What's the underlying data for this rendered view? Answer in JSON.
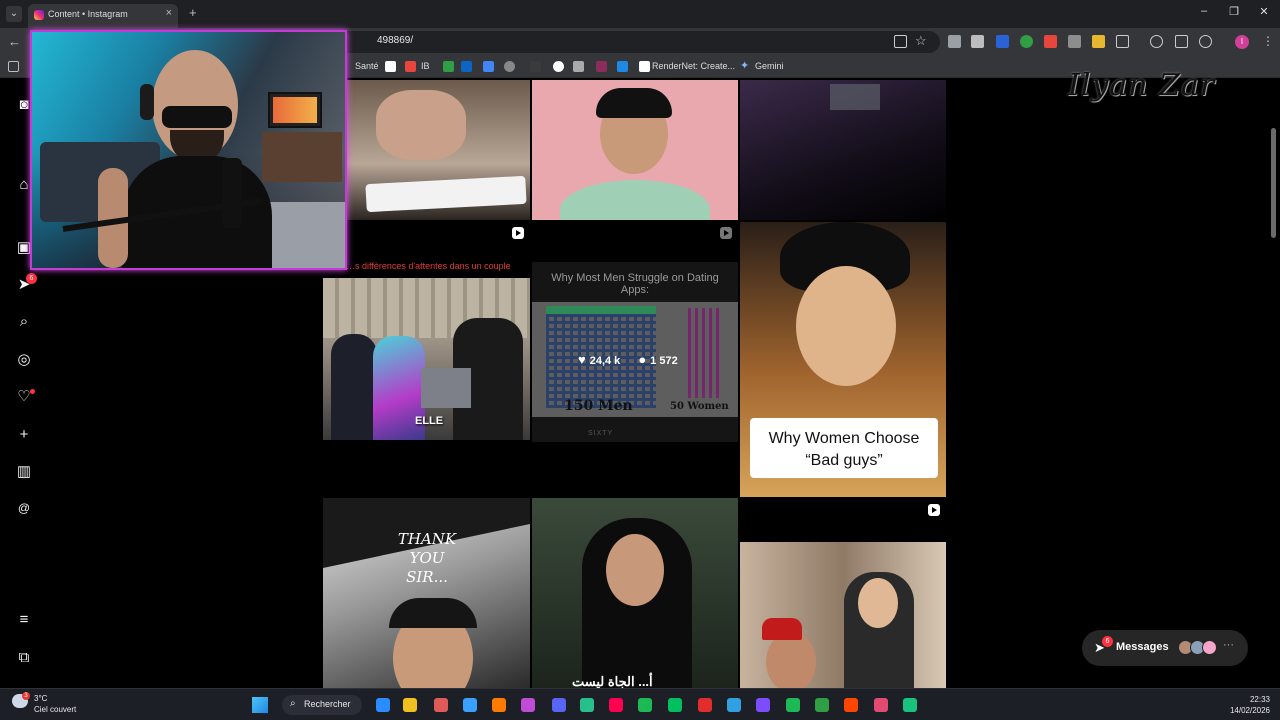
{
  "browser": {
    "tab_title": "Content • Instagram",
    "tab_close": "×",
    "new_tab": "+",
    "url_visible": "498869/",
    "bookmarks": [
      {
        "label": "Santé",
        "color": "#3b3b3b"
      },
      {
        "label": "IB",
        "color": "#e8453c"
      },
      {
        "label": "RenderNet: Create...",
        "color": "#ffffff"
      },
      {
        "label": "Gemini",
        "color": "#8ab4f8"
      }
    ],
    "window_controls": [
      "–",
      "❐",
      "✕"
    ],
    "profile_initial": "I"
  },
  "sidebar": {
    "notification_count": "6",
    "icons": [
      "instagram-logo-icon",
      "home-icon",
      "reels-icon",
      "messages-icon",
      "search-icon",
      "explore-icon",
      "notifications-heart-icon",
      "create-plus-icon",
      "dashboard-icon",
      "threads-icon",
      "more-menu-icon",
      "meta-icon"
    ]
  },
  "grid": {
    "tiles": [
      {
        "id": "t1",
        "overlay_text": ""
      },
      {
        "id": "t2",
        "overlay_text": ""
      },
      {
        "id": "t3",
        "overlay_text": ""
      },
      {
        "id": "t4",
        "overlay_text": "ELLE",
        "caption": "…s différences d'attentes dans un couple"
      },
      {
        "id": "t5",
        "headline": "Why Most Men Struggle on Dating Apps:",
        "left_label": "150 Men",
        "right_label": "50 Women",
        "credit": "SIXTY"
      },
      {
        "id": "t6",
        "overlay_text": "Why Women Choose “Bad guys”"
      },
      {
        "id": "t7",
        "overlay_text": "THANK YOU SIR..."
      },
      {
        "id": "t8",
        "overlay_text": "أ... الجاة ليست"
      },
      {
        "id": "t9",
        "overlay_text": ""
      }
    ],
    "hover_stats": {
      "likes": "24,4 k",
      "comments": "1 572"
    }
  },
  "watermark": "Ilyan Zar",
  "messages": {
    "label": "Messages",
    "badge": "6"
  },
  "taskbar": {
    "weather_temp": "3°C",
    "weather_desc": "Ciel couvert",
    "search_label": "Rechercher",
    "time": "22:33",
    "date": "14/02/2026",
    "app_colors": [
      "#2a8cff",
      "#f0c020",
      "#e05a5a",
      "#3aa0ff",
      "#ff7a00",
      "#c04cd6",
      "#5865f2",
      "#27c08a",
      "#ff0050",
      "#1db954",
      "#00c060",
      "#e22d2d",
      "#30a0e0",
      "#7b4dff",
      "#1db954",
      "#2f9e44",
      "#ff4500",
      "#e14a72",
      "#19c37d"
    ]
  }
}
